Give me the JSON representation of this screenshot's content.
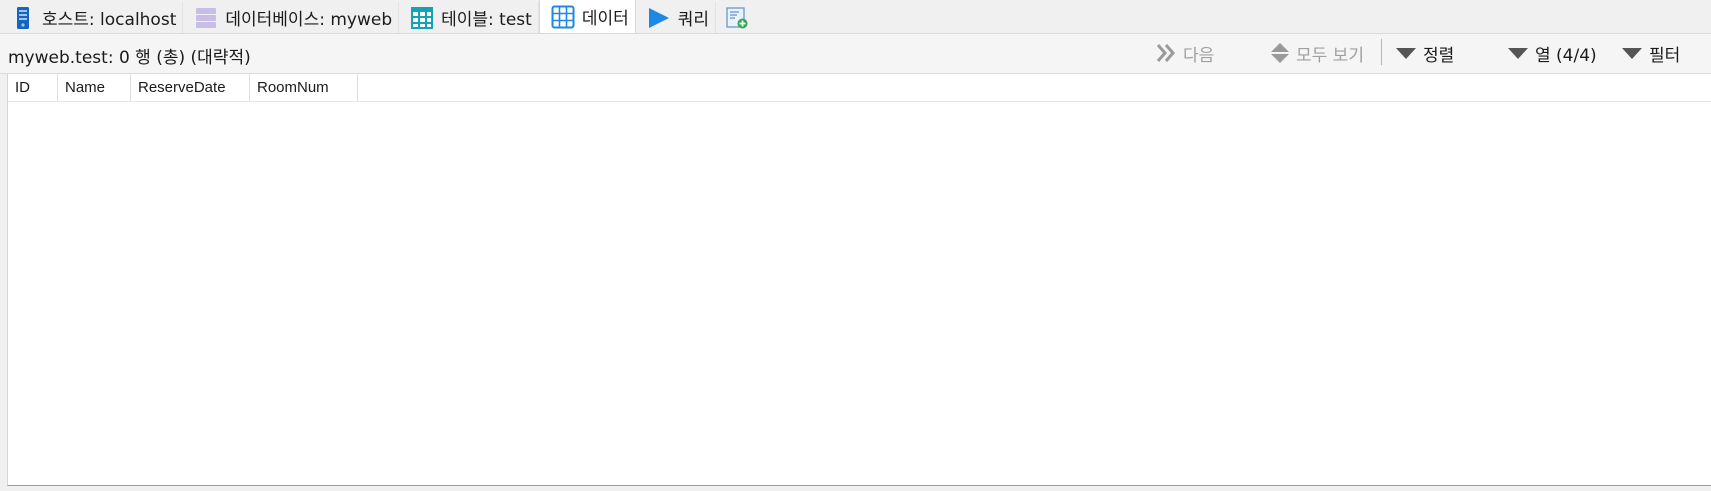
{
  "tabs": [
    {
      "label": "호스트: localhost",
      "icon": "server-icon"
    },
    {
      "label": "데이터베이스: myweb",
      "icon": "database-icon"
    },
    {
      "label": "테이블: test",
      "icon": "table-icon"
    },
    {
      "label": "데이터",
      "icon": "data-grid-icon",
      "active": true
    },
    {
      "label": "쿼리",
      "icon": "play-icon"
    },
    {
      "label": "",
      "icon": "new-query-tab-icon"
    }
  ],
  "toolbar": {
    "status_text": "myweb.test: 0 행 (총) (대략적)",
    "next_label": "다음",
    "show_all_label": "모두 보기",
    "sort_label": "정렬",
    "columns_label": "열 (4/4)",
    "filter_label": "필터"
  },
  "grid": {
    "columns": [
      "ID",
      "Name",
      "ReserveDate",
      "RoomNum"
    ],
    "rows": []
  },
  "colors": {
    "accent_blue": "#1e88e5",
    "table_teal": "#11a3b8",
    "database_lavender": "#c8bde6",
    "disabled_text": "#a0a0a0",
    "toolbar_icon": "#555555"
  }
}
